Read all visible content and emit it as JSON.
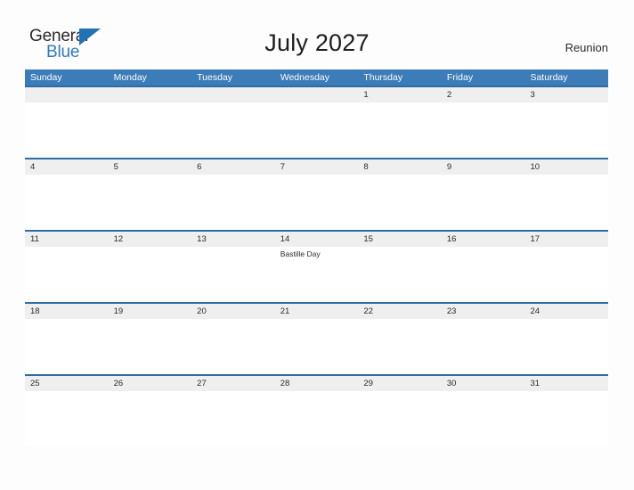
{
  "brand": {
    "name_part1": "General",
    "name_part2": "Blue",
    "triangle_icon": "triangle-icon",
    "accent_color": "#2272b8"
  },
  "header": {
    "title": "July 2027",
    "region": "Reunion"
  },
  "colors": {
    "header_blue": "#3b7cb9",
    "divider_blue": "#2e6da4",
    "date_band_gray": "#efefef",
    "page_background": "#fdfdfd",
    "text_dark": "#2b2b2b",
    "logo_blue": "#2e7ac4"
  },
  "calendar": {
    "weekdays": [
      "Sunday",
      "Monday",
      "Tuesday",
      "Wednesday",
      "Thursday",
      "Friday",
      "Saturday"
    ],
    "weeks": [
      [
        {
          "day": ""
        },
        {
          "day": ""
        },
        {
          "day": ""
        },
        {
          "day": ""
        },
        {
          "day": "1"
        },
        {
          "day": "2"
        },
        {
          "day": "3"
        }
      ],
      [
        {
          "day": "4"
        },
        {
          "day": "5"
        },
        {
          "day": "6"
        },
        {
          "day": "7"
        },
        {
          "day": "8"
        },
        {
          "day": "9"
        },
        {
          "day": "10"
        }
      ],
      [
        {
          "day": "11"
        },
        {
          "day": "12"
        },
        {
          "day": "13"
        },
        {
          "day": "14",
          "event": "Bastille Day"
        },
        {
          "day": "15"
        },
        {
          "day": "16"
        },
        {
          "day": "17"
        }
      ],
      [
        {
          "day": "18"
        },
        {
          "day": "19"
        },
        {
          "day": "20"
        },
        {
          "day": "21"
        },
        {
          "day": "22"
        },
        {
          "day": "23"
        },
        {
          "day": "24"
        }
      ],
      [
        {
          "day": "25"
        },
        {
          "day": "26"
        },
        {
          "day": "27"
        },
        {
          "day": "28"
        },
        {
          "day": "29"
        },
        {
          "day": "30"
        },
        {
          "day": "31"
        }
      ]
    ]
  }
}
